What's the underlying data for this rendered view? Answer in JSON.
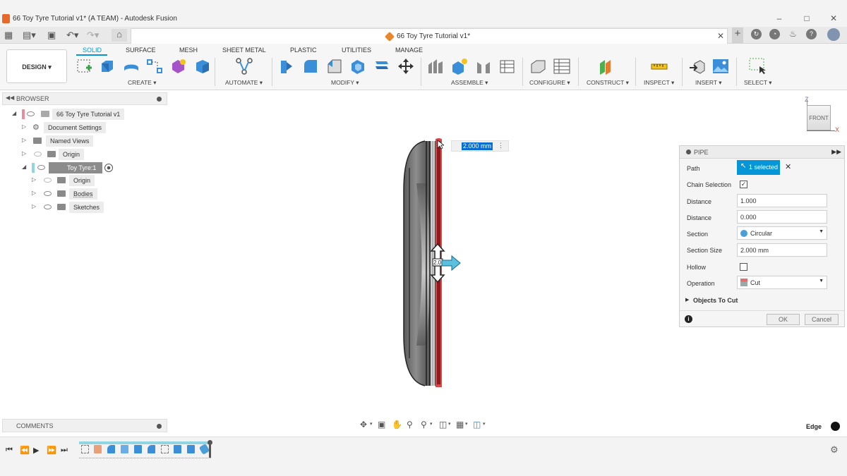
{
  "window": {
    "title": "66 Toy Tyre Tutorial v1* (A TEAM) - Autodesk Fusion"
  },
  "tabbar": {
    "doc_tab_title": "66 Toy Tyre Tutorial v1*"
  },
  "ribbon": {
    "workspace_label": "DESIGN ▾",
    "tabs": [
      "SOLID",
      "SURFACE",
      "MESH",
      "SHEET METAL",
      "PLASTIC",
      "UTILITIES",
      "MANAGE"
    ],
    "groups": [
      "CREATE ▾",
      "AUTOMATE ▾",
      "MODIFY ▾",
      "ASSEMBLE ▾",
      "CONFIGURE ▾",
      "CONSTRUCT ▾",
      "INSPECT ▾",
      "INSERT ▾",
      "SELECT ▾"
    ]
  },
  "browser": {
    "header": "BROWSER",
    "items": [
      {
        "label": "66 Toy Tyre Tutorial v1"
      },
      {
        "label": "Document Settings"
      },
      {
        "label": "Named Views"
      },
      {
        "label": "Origin"
      },
      {
        "label": "Toy Tyre:1"
      },
      {
        "label": "Origin"
      },
      {
        "label": "Bodies"
      },
      {
        "label": "Sketches"
      }
    ]
  },
  "viewport": {
    "dimension_value": "2.000 mm",
    "viewcube_label": "FRONT",
    "axis_z": "Z",
    "axis_x": "X",
    "manipulator_label": "2.0"
  },
  "pipe_dialog": {
    "title": "PIPE",
    "path_label": "Path",
    "path_selection": "1 selected",
    "chain_label": "Chain Selection",
    "distance1_label": "Distance",
    "distance1_value": "1.000",
    "distance2_label": "Distance",
    "distance2_value": "0.000",
    "section_label": "Section",
    "section_value": "Circular",
    "section_size_label": "Section Size",
    "section_size_value": "2.000 mm",
    "hollow_label": "Hollow",
    "operation_label": "Operation",
    "operation_value": "Cut",
    "objects_label": "Objects To Cut",
    "ok_label": "OK",
    "cancel_label": "Cancel"
  },
  "comments": {
    "header": "COMMENTS"
  },
  "status": {
    "selection_filter": "Edge"
  },
  "colors": {
    "accent": "#0696d7",
    "selected_edge": "#c0282c",
    "titlebar": "#f3f3f3"
  }
}
